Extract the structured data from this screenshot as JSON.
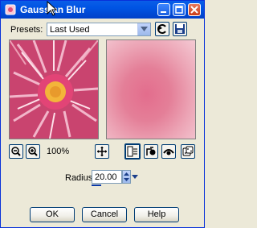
{
  "window": {
    "title": "Gaussian Blur"
  },
  "presets": {
    "label": "Presets:",
    "value": "Last Used"
  },
  "zoom": {
    "level": "100%"
  },
  "radius": {
    "label": "Radius:",
    "value": "20.00"
  },
  "buttons": {
    "ok": "OK",
    "cancel": "Cancel",
    "help": "Help"
  },
  "icons": {
    "app": "blur-app-icon",
    "minimize": "minimize-icon",
    "maximize": "maximize-icon",
    "close": "close-icon",
    "reset": "reset-arrow-icon",
    "save_preset": "floppy-disk-icon",
    "zoom_out": "zoom-out-icon",
    "zoom_in": "zoom-in-icon",
    "pan": "pan-move-icon",
    "proof": "proof-toggle-icon",
    "preview_on": "preview-image-icon",
    "preview_toggle": "eye-icon",
    "randomize": "dice-icon"
  },
  "colors": {
    "title_bar": "#0054e3",
    "dialog_bg": "#ece9d8",
    "close": "#c93c18"
  }
}
